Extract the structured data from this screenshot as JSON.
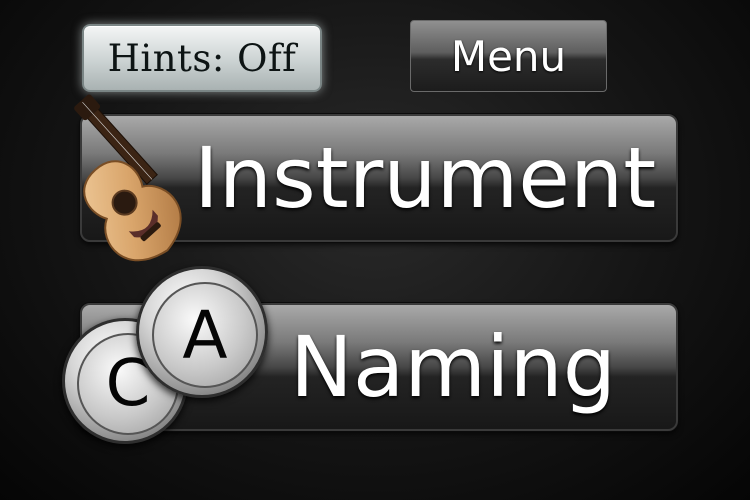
{
  "header": {
    "hints_label": "Hints: Off",
    "menu_label": "Menu"
  },
  "main": {
    "instrument_label": "Instrument",
    "naming_label": "Naming",
    "note_badges": [
      "C",
      "A"
    ]
  },
  "icons": {
    "instrument": "acoustic-guitar-icon",
    "naming": "note-letter-balls-icon"
  },
  "colors": {
    "hints_button": "#cfd6d6",
    "menu_button": "#5e5e5e",
    "big_button": "#474747",
    "background": "#141414"
  }
}
